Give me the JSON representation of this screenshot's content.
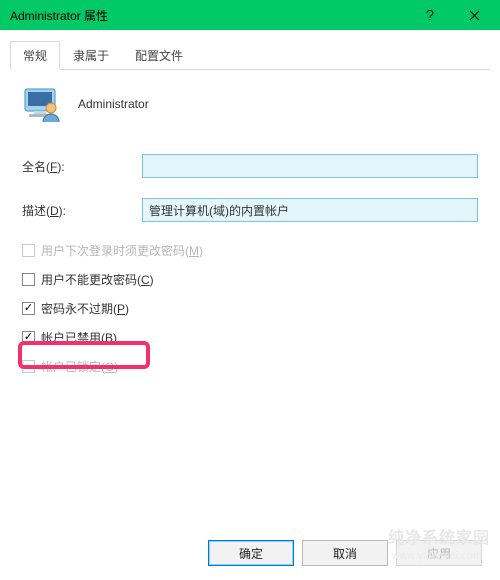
{
  "title": "Administrator 属性",
  "tabs": [
    "常规",
    "隶属于",
    "配置文件"
  ],
  "activeTab": 0,
  "user": {
    "name": "Administrator"
  },
  "fields": {
    "fullname": {
      "label": "全名(",
      "hot": "F",
      "suffix": "):",
      "value": ""
    },
    "description": {
      "label": "描述(",
      "hot": "D",
      "suffix": "):",
      "value": "管理计算机(域)的内置帐户"
    }
  },
  "checks": [
    {
      "label": "用户下次登录时须更改密码(",
      "hot": "M",
      "suffix": ")",
      "checked": false,
      "disabled": true
    },
    {
      "label": "用户不能更改密码(",
      "hot": "C",
      "suffix": ")",
      "checked": false,
      "disabled": false
    },
    {
      "label": "密码永不过期(",
      "hot": "P",
      "suffix": ")",
      "checked": true,
      "disabled": false
    },
    {
      "label": "帐户已禁用(",
      "hot": "B",
      "suffix": ")",
      "checked": true,
      "disabled": false
    },
    {
      "label": "帐户已锁定(",
      "hot": "O",
      "suffix": ")",
      "checked": false,
      "disabled": true
    }
  ],
  "buttons": {
    "ok": "确定",
    "cancel": "取消",
    "apply": "应用"
  },
  "watermark": {
    "line1": "纯净系统家园",
    "line2": "www.yidaimei.com"
  }
}
